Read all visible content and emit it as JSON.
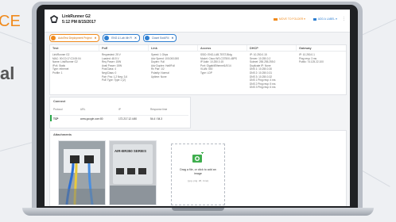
{
  "page": {
    "side_text_top": "CE",
    "side_text_bottom": "al"
  },
  "app": {
    "title": "LinkRunner G2",
    "timestamp": "5:12 PM 8/15/2017",
    "move_button": "MOVE TO FOLDER",
    "label_button": "ADD A LABEL"
  },
  "tags": [
    {
      "label": "AutoTest Deployment Project",
      "color": "#f08a1c"
    },
    {
      "label": "ENG & Lab 4th Fl",
      "color": "#2f7fd1"
    },
    {
      "label": "Closet Sw4/R4",
      "color": "#2f7fd1"
    }
  ],
  "columns": [
    {
      "title": "Test",
      "lines": [
        "LinkRunner G2",
        "MAC: 00:C0:17:C3:00:04",
        "Name: LinkRunner G2",
        "IPv4: Static",
        "Type: ethernet",
        "Profile: 1"
      ]
    },
    {
      "title": "PoE",
      "lines": [
        "Requested: 25 V",
        "Loaded: 48.5 V",
        "Req Power: 15W",
        "Avail Power: 15W",
        "Pos/Class: 4",
        "Neg/Class: 0",
        "Pair: Pos: 1,2 Neg: 3,6",
        "PoE Type: Type 1 (2)"
      ]
    },
    {
      "title": "Link",
      "lines": [
        "Speed: 1 Gbps",
        "Adv Speed: 10/100/1000",
        "Duplex: Full",
        "Adv Duplex: Half/Full",
        "Rx Pair: 1/2",
        "Polarity: Normal",
        "Uptime: None"
      ]
    },
    {
      "title": "Access",
      "lines": [
        "SSID: ENG-LAB-TEST-Bldg",
        "Model: Cisco WS-C3750X-48PS",
        "IP Addr: 10.250.0.15",
        "Port: GigabitEthernet1/0/14",
        "VLAN: 500",
        "Type: LDP"
      ]
    },
    {
      "title": "DHCP",
      "lines": [
        "IP: 10.250.0.15",
        "Server: 10.250.0.2",
        "Subnet: 255.255.255.0",
        "Duplicate IP: None",
        "DNS 1: 10.250.0.30",
        "DNS 2: 10.250.0.31",
        "DNS 3: 10.250.0.32",
        "DNS 1 Ping resp: 4 ms",
        "DNS 2 Ping resp: 5 ms",
        "DNS 3 Ping resp: 6 ms"
      ]
    },
    {
      "title": "Gateway",
      "lines": [
        "IP: 10.250.0.1",
        "Ping resp: 3 ms",
        "Public: 74.125.22.100"
      ]
    }
  ],
  "connect": {
    "title": "Connect",
    "headers": [
      "Protocol",
      "URL",
      "IP",
      "Response time"
    ],
    "row": [
      "TCP",
      "www.google.com:80",
      "172.217.12.4:80",
      "54.4 / 54.3"
    ]
  },
  "attachments": {
    "title": "Attachments",
    "upload_text": "Drag a file, or click to add an image",
    "upload_hint": "(.jpg .png .tiff, .bmp)",
    "device_label": "AIR-BR350 SERIES"
  }
}
